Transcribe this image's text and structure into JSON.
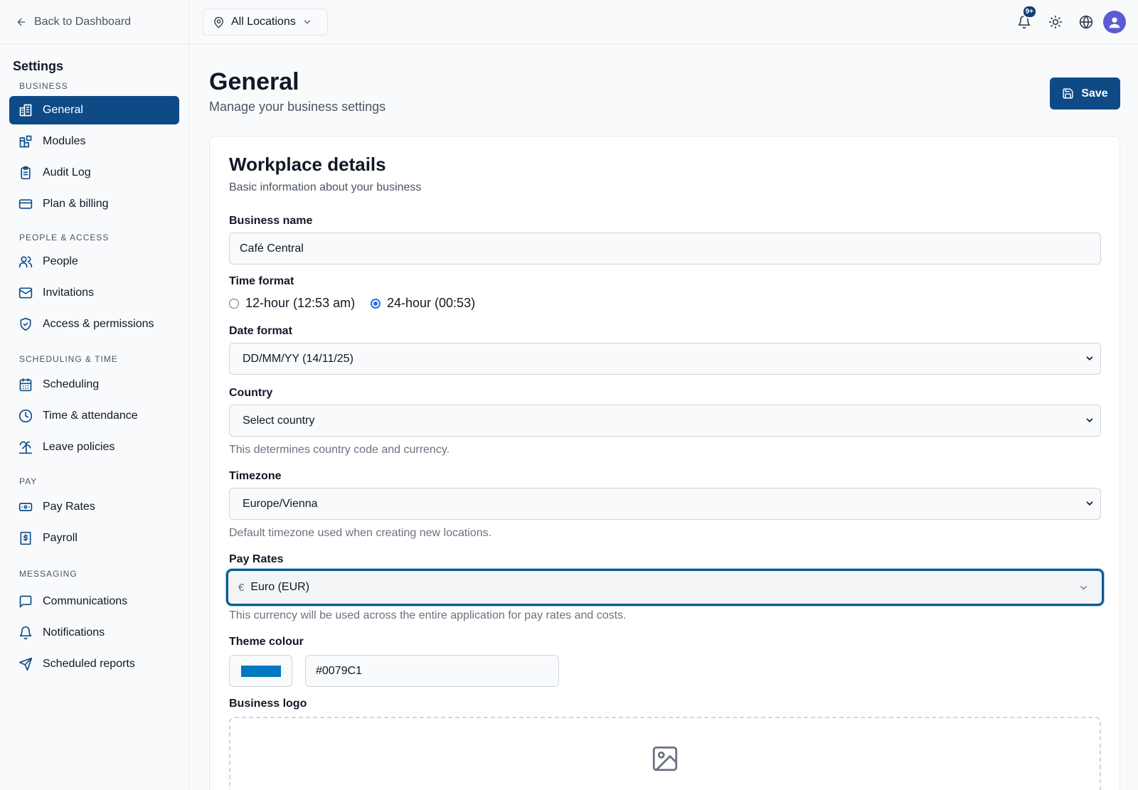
{
  "sidebar": {
    "back_label": "Back to Dashboard",
    "title": "Settings",
    "sections": [
      {
        "label": "BUSINESS",
        "items": [
          {
            "label": "General",
            "icon": "building-icon",
            "active": true
          },
          {
            "label": "Modules",
            "icon": "modules-icon"
          },
          {
            "label": "Audit Log",
            "icon": "clipboard-icon"
          },
          {
            "label": "Plan & billing",
            "icon": "credit-card-icon"
          }
        ]
      },
      {
        "label": "PEOPLE & ACCESS",
        "items": [
          {
            "label": "People",
            "icon": "users-icon"
          },
          {
            "label": "Invitations",
            "icon": "mail-icon"
          },
          {
            "label": "Access & permissions",
            "icon": "shield-check-icon"
          }
        ]
      },
      {
        "label": "SCHEDULING & TIME",
        "items": [
          {
            "label": "Scheduling",
            "icon": "calendar-icon"
          },
          {
            "label": "Time & attendance",
            "icon": "clock-icon"
          },
          {
            "label": "Leave policies",
            "icon": "palm-tree-icon"
          }
        ]
      },
      {
        "label": "PAY",
        "items": [
          {
            "label": "Pay Rates",
            "icon": "banknote-icon"
          },
          {
            "label": "Payroll",
            "icon": "receipt-dollar-icon"
          }
        ]
      },
      {
        "label": "MESSAGING",
        "items": [
          {
            "label": "Communications",
            "icon": "message-square-icon"
          },
          {
            "label": "Notifications",
            "icon": "bell-icon"
          },
          {
            "label": "Scheduled reports",
            "icon": "send-icon"
          }
        ]
      }
    ]
  },
  "topbar": {
    "location_label": "All Locations",
    "notification_badge": "9+"
  },
  "header": {
    "title": "General",
    "subtitle": "Manage your business settings",
    "save_label": "Save"
  },
  "card": {
    "title": "Workplace details",
    "subtitle": "Basic information about your business",
    "business_name_label": "Business name",
    "business_name_value": "Café Central",
    "time_format_label": "Time format",
    "time_options": [
      "12-hour (12:53 am)",
      "24-hour (00:53)"
    ],
    "time_selected": "24-hour (00:53)",
    "date_format_label": "Date format",
    "date_format_value": "DD/MM/YY (14/11/25)",
    "country_label": "Country",
    "country_value": "Select country",
    "country_help": "This determines country code and currency.",
    "timezone_label": "Timezone",
    "timezone_value": "Europe/Vienna",
    "timezone_help": "Default timezone used when creating new locations.",
    "pay_rates_label": "Pay Rates",
    "currency_symbol": "€",
    "currency_value": "Euro (EUR)",
    "pay_rates_help": "This currency will be used across the entire application for pay rates and costs.",
    "theme_label": "Theme colour",
    "theme_value": "#0079C1",
    "theme_color": "#0079C1",
    "logo_label": "Business logo",
    "logo_icon": "image-icon"
  },
  "colors": {
    "primary": "#0e4a86",
    "focus": "#0b5a8e"
  }
}
